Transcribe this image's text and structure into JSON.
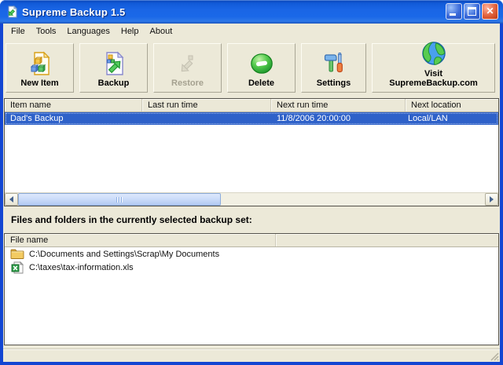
{
  "colors": {
    "titlebar_blue": "#1a66e6",
    "window_border_blue": "#1346d2",
    "chrome_beige": "#ece9d8",
    "selection_blue": "#2e61c9",
    "header_beige": "#ebe8d7"
  },
  "window": {
    "title": "Supreme Backup 1.5",
    "controls": [
      "minimize",
      "maximize",
      "close"
    ]
  },
  "menu": {
    "items": [
      "File",
      "Tools",
      "Languages",
      "Help",
      "About"
    ]
  },
  "toolbar": {
    "buttons": [
      {
        "label": "New Item",
        "icon": "new-item-icon",
        "enabled": true
      },
      {
        "label": "Backup",
        "icon": "backup-icon",
        "enabled": true
      },
      {
        "label": "Restore",
        "icon": "restore-icon",
        "enabled": false
      },
      {
        "label": "Delete",
        "icon": "delete-icon",
        "enabled": true
      },
      {
        "label": "Settings",
        "icon": "settings-icon",
        "enabled": true
      },
      {
        "label_line1": "Visit",
        "label_line2": "SupremeBackup.com",
        "icon": "globe-icon",
        "enabled": true
      }
    ]
  },
  "backup_list": {
    "columns": [
      "Item name",
      "Last run time",
      "Next run time",
      "Next location"
    ],
    "rows": [
      {
        "item_name": "Dad's Backup",
        "last_run_time": "",
        "next_run_time": "11/8/2006 20:00:00",
        "next_location": "Local/LAN",
        "selected": true
      }
    ]
  },
  "files_section": {
    "label": "Files and folders in the currently selected backup set:",
    "columns": [
      "File name"
    ],
    "rows": [
      {
        "icon": "folder-icon",
        "file_name": "C:\\Documents and Settings\\Scrap\\My Documents"
      },
      {
        "icon": "excel-file-icon",
        "file_name": "C:\\taxes\\tax-information.xls"
      }
    ]
  }
}
